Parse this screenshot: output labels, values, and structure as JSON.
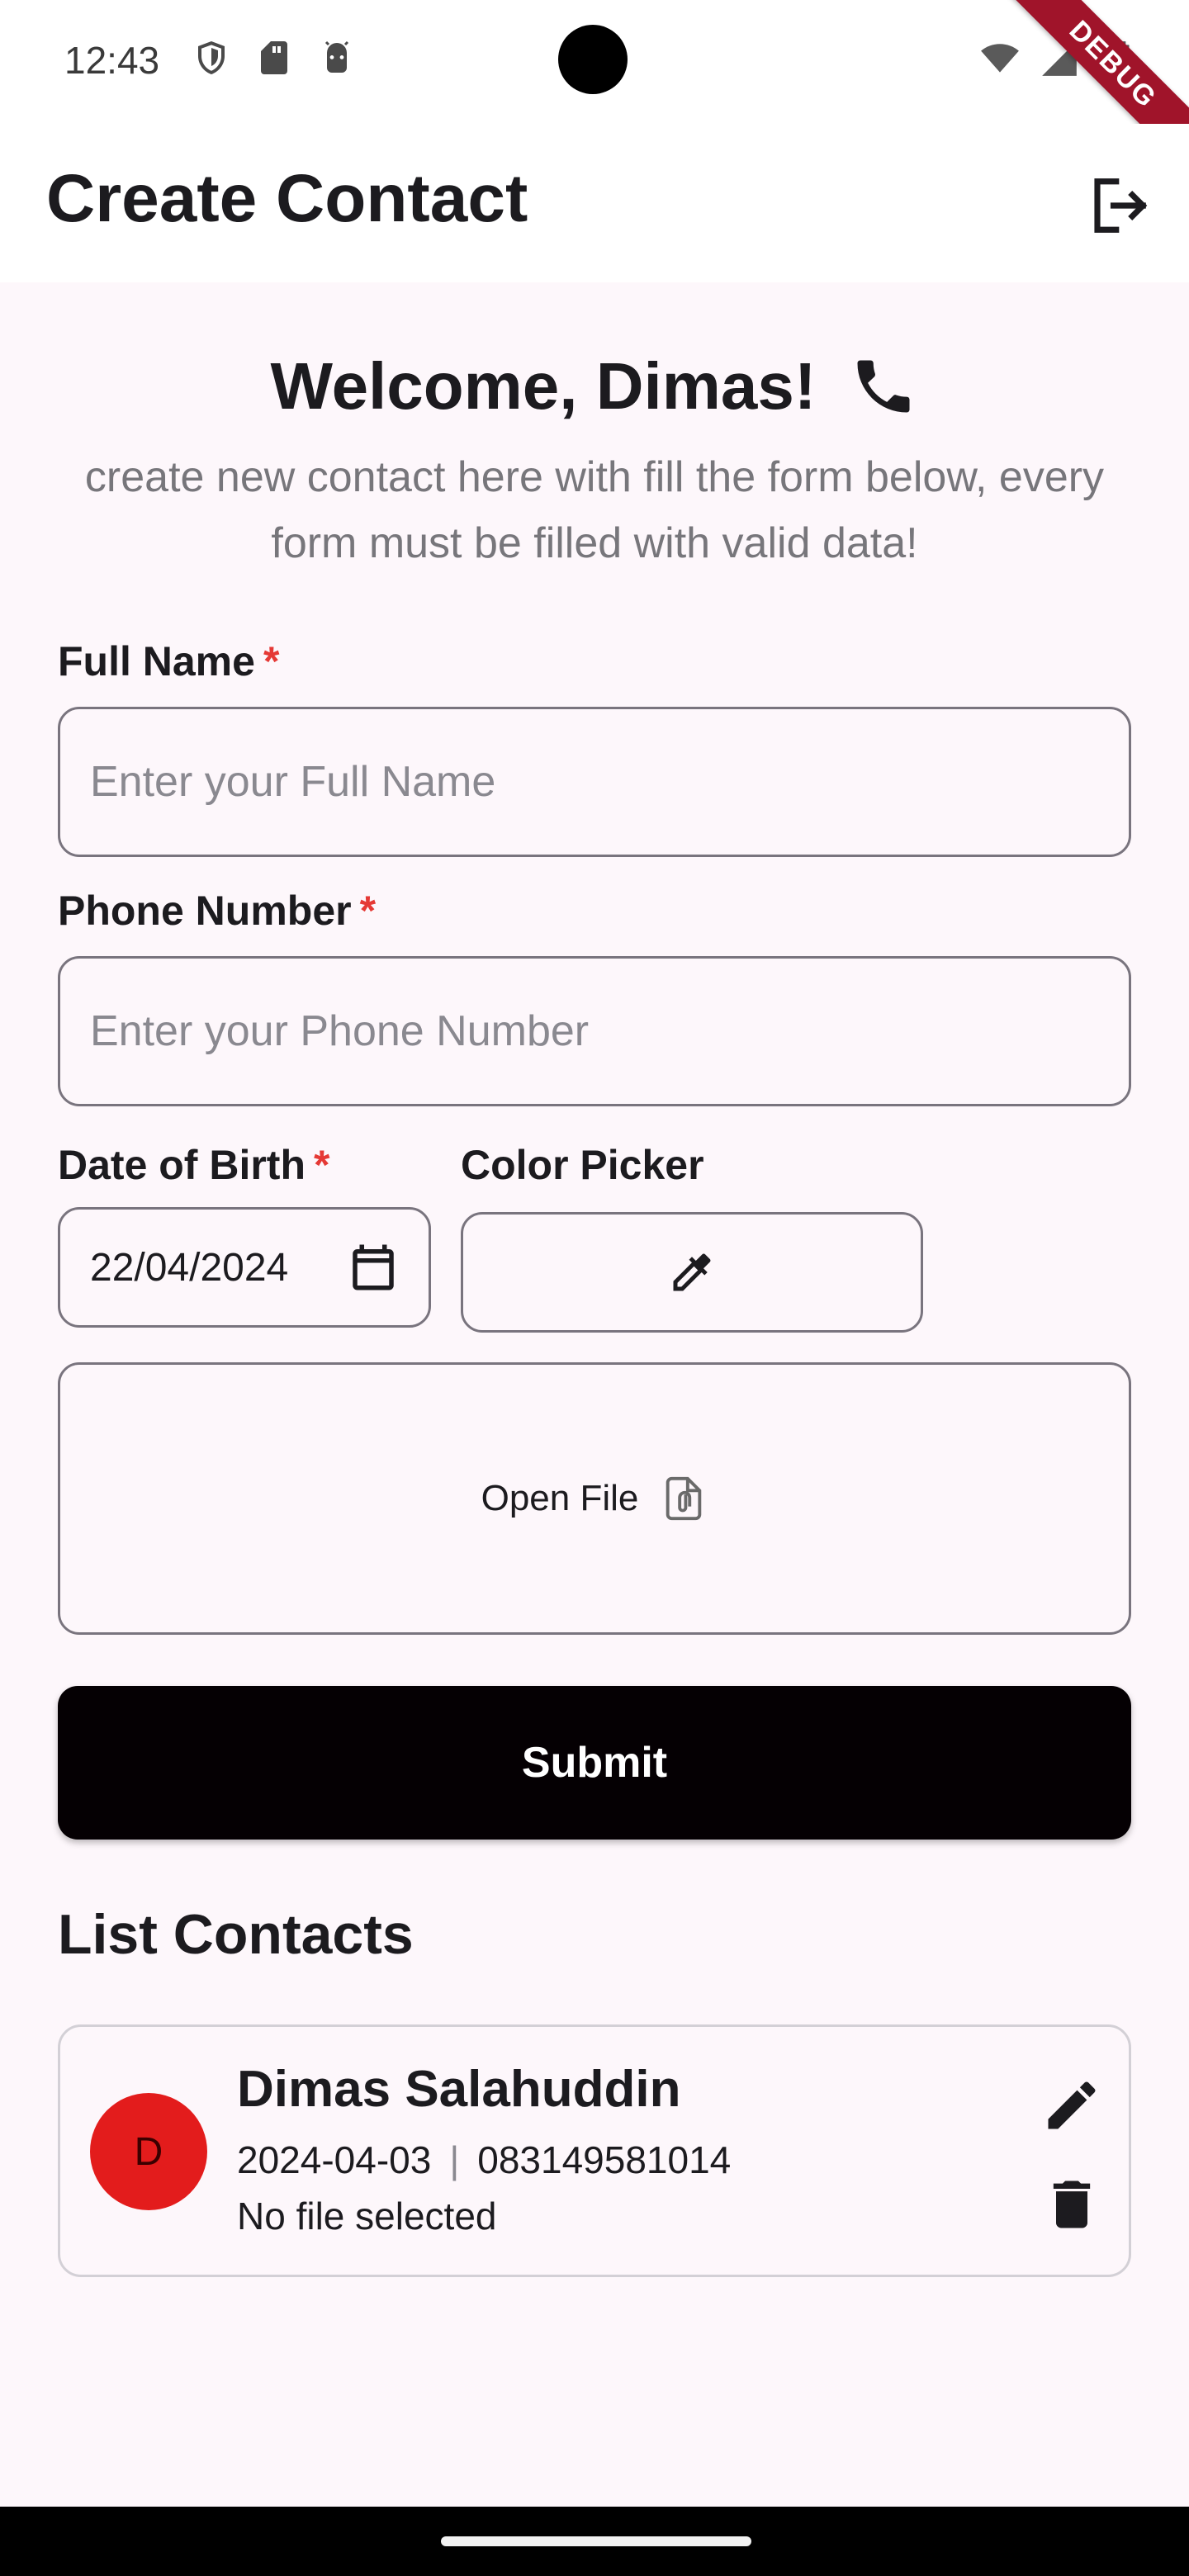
{
  "status_bar": {
    "time": "12:43",
    "left_icons": [
      "shield-icon",
      "sd-card-icon",
      "android-debug-icon"
    ],
    "right_icons": [
      "wifi-icon",
      "signal-icon",
      "battery-icon"
    ],
    "debug_banner": "DEBUG"
  },
  "app_bar": {
    "title": "Create Contact",
    "action_icon": "logout-icon"
  },
  "header": {
    "title": "Welcome, Dimas!",
    "title_icon": "phone-icon",
    "subtitle": "create new contact here with fill the form below, every form must be filled with valid data!"
  },
  "form": {
    "full_name": {
      "label": "Full Name",
      "required_mark": "*",
      "placeholder": "Enter your Full Name",
      "value": ""
    },
    "phone": {
      "label": "Phone Number",
      "required_mark": "*",
      "placeholder": "Enter your Phone Number",
      "value": ""
    },
    "dob": {
      "label": "Date of Birth",
      "required_mark": "*",
      "value": "22/04/2024",
      "icon": "calendar-icon"
    },
    "color_picker": {
      "label": "Color Picker",
      "icon": "eyedropper-icon"
    },
    "file": {
      "label": "Open File",
      "icon": "attach-file-icon"
    },
    "submit_label": "Submit"
  },
  "contacts": {
    "title": "List Contacts",
    "items": [
      {
        "initial": "D",
        "name": "Dimas Salahuddin",
        "date": "2024-04-03",
        "separator": "|",
        "phone": "083149581014",
        "file_status": "No file selected",
        "avatar_color": "#e31c1c",
        "edit_icon": "edit-icon",
        "delete_icon": "delete-icon"
      }
    ]
  },
  "colors": {
    "background": "#fdf7fb",
    "submit_bg": "#050003",
    "required": "#e53935",
    "outline": "#79747e"
  }
}
